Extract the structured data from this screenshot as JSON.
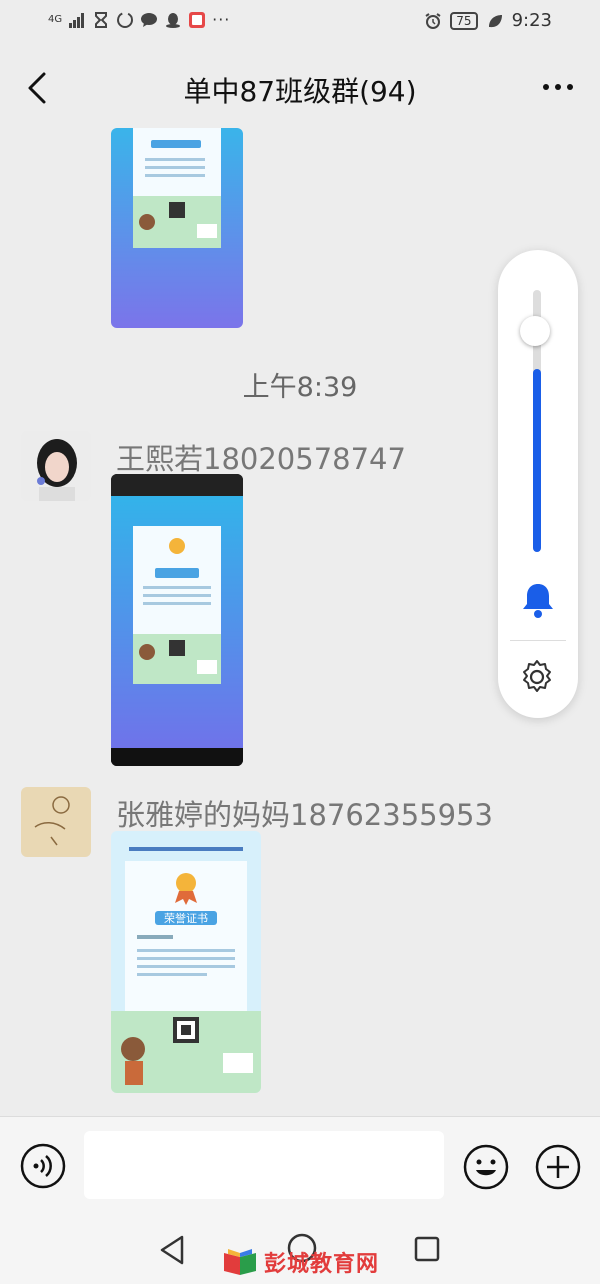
{
  "status_bar": {
    "network": "4G",
    "battery": "75",
    "time": "9:23"
  },
  "header": {
    "title": "单中87班级群(94)"
  },
  "messages": {
    "timestamp": "上午8:39",
    "sender1": "王熙若18020578747",
    "sender2": "张雅婷的妈妈18762355953"
  },
  "certificate": {
    "title": "荣誉证书"
  },
  "input": {
    "placeholder": ""
  },
  "volume": {
    "level": 0.85
  },
  "watermark": {
    "text": "彭城教育网"
  },
  "colors": {
    "accent": "#1a5ee8",
    "cert_blue": "#3aa9e6",
    "cert_purple": "#7a7ee8",
    "watermark_red": "#e23c3c"
  }
}
